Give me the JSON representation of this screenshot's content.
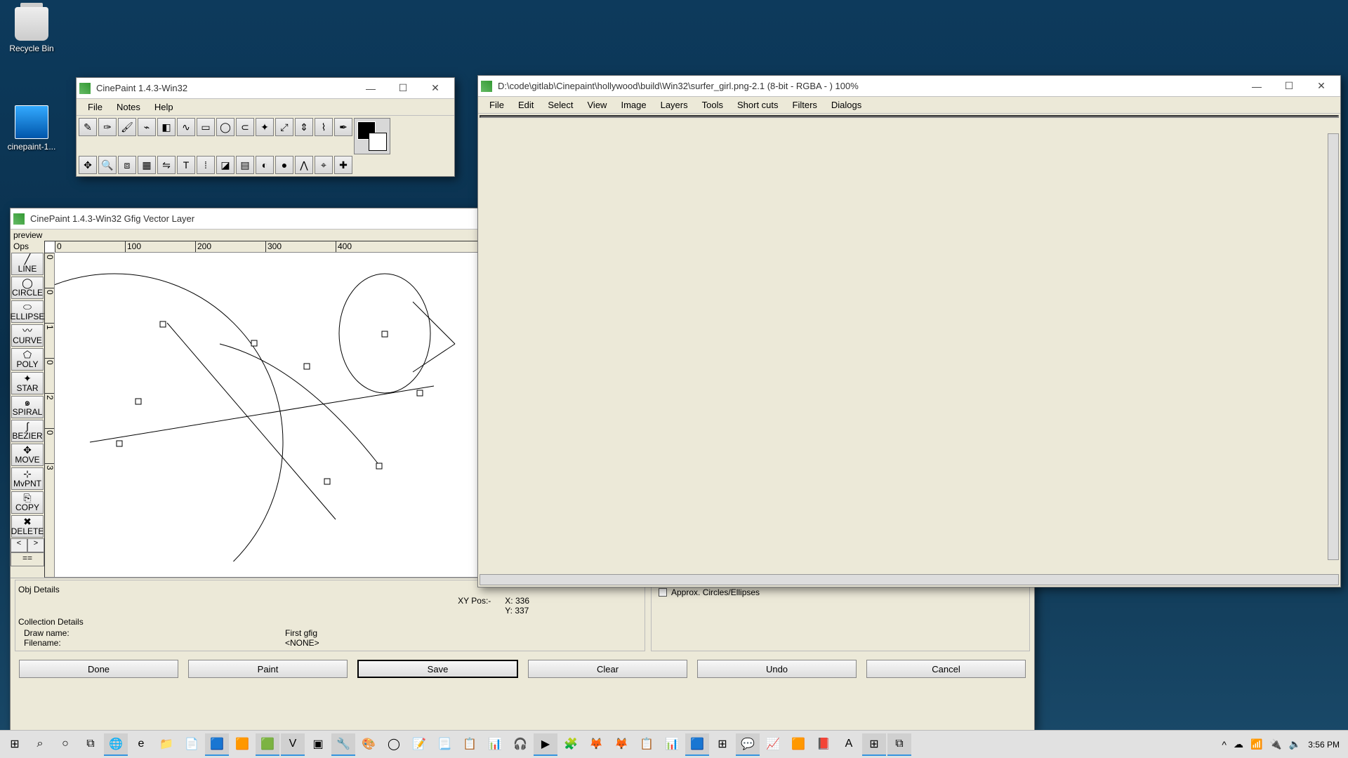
{
  "desktop": {
    "recycle_bin": "Recycle Bin",
    "shortcut": "cinepaint-1..."
  },
  "toolbox_window": {
    "title": "CinePaint 1.4.3-Win32",
    "menu": [
      "File",
      "Notes",
      "Help"
    ],
    "tools_row1": [
      "pencil",
      "pen",
      "brush",
      "stamp",
      "eraser",
      "smudge",
      "rect-sel",
      "ellipse-sel",
      "lasso",
      "wand",
      "color-pick",
      "measure",
      "path",
      "text-cursor"
    ],
    "tools_row2": [
      "move",
      "zoom",
      "crop",
      "transform",
      "flip",
      "text",
      "eyedrop",
      "bucket",
      "gradient",
      "blur",
      "sharpen",
      "dodge",
      "clone",
      "heal"
    ]
  },
  "gfig_window": {
    "title": "CinePaint 1.4.3-Win32 Gfig Vector Layer",
    "preview_label": "preview",
    "ops_label": "Ops",
    "ops": [
      {
        "name": "line",
        "label": "LINE"
      },
      {
        "name": "circle",
        "label": "CIRCLE"
      },
      {
        "name": "ellipse",
        "label": "ELLIPSE"
      },
      {
        "name": "curve",
        "label": "CURVE"
      },
      {
        "name": "poly",
        "label": "POLY"
      },
      {
        "name": "star",
        "label": "STAR"
      },
      {
        "name": "spiral",
        "label": "SPIRAL"
      },
      {
        "name": "bezier",
        "label": "BEZIER"
      },
      {
        "name": "move",
        "label": "MOVE"
      },
      {
        "name": "mvpnt",
        "label": "MvPNT"
      },
      {
        "name": "copy",
        "label": "COPY"
      },
      {
        "name": "delete",
        "label": "DELETE"
      }
    ],
    "nav_prev": "<",
    "nav_next": ">",
    "nav_all": "==",
    "ruler_h": [
      "0",
      "100",
      "200",
      "300",
      "400"
    ],
    "ruler_v": [
      "0",
      "0",
      "1",
      "0",
      "2",
      "0",
      "3"
    ],
    "obj_details": "Obj Details",
    "xy_label": "XY Pos:-",
    "x_label": "X:",
    "x_val": "336",
    "y_label": "Y:",
    "y_val": "337",
    "collection_details": "Collection Details",
    "draw_name_label": "Draw name:",
    "draw_name_value": "First gfig",
    "filename_label": "Filename:",
    "filename_value": "<NONE>",
    "approx_checkbox": "Approx. Circles/Ellipses",
    "buttons": {
      "done": "Done",
      "paint": "Paint",
      "save": "Save",
      "clear": "Clear",
      "undo": "Undo",
      "cancel": "Cancel"
    }
  },
  "image_window": {
    "title": "D:\\code\\gitlab\\Cinepaint\\hollywood\\build\\Win32\\surfer_girl.png-2.1 (8-bit - RGBA - ) 100%",
    "menu": [
      "File",
      "Edit",
      "Select",
      "View",
      "Image",
      "Layers",
      "Tools",
      "Short cuts",
      "Filters",
      "Dialogs"
    ]
  },
  "taskbar": {
    "start_glyph": "⊞",
    "search_glyph": "⌕",
    "cortana_glyph": "○",
    "taskview_glyph": "⧉",
    "apps": [
      "🌐",
      "e",
      "📁",
      "📄",
      "🟦",
      "🟧",
      "🟩",
      "V",
      "▣",
      "🔧",
      "🎨",
      "◯",
      "📝",
      "📃",
      "📋",
      "📊",
      "🎧",
      "▶",
      "🧩",
      "🦊",
      "🦊",
      "📋",
      "📊",
      "🟦",
      "⊞",
      "💬",
      "📈",
      "🟧",
      "📕",
      "A",
      "⊞",
      "⧉"
    ],
    "tray_up": "^",
    "tray_icons": [
      "☁",
      "📶",
      "🔌",
      "🔈"
    ],
    "clock": "3:56 PM"
  }
}
